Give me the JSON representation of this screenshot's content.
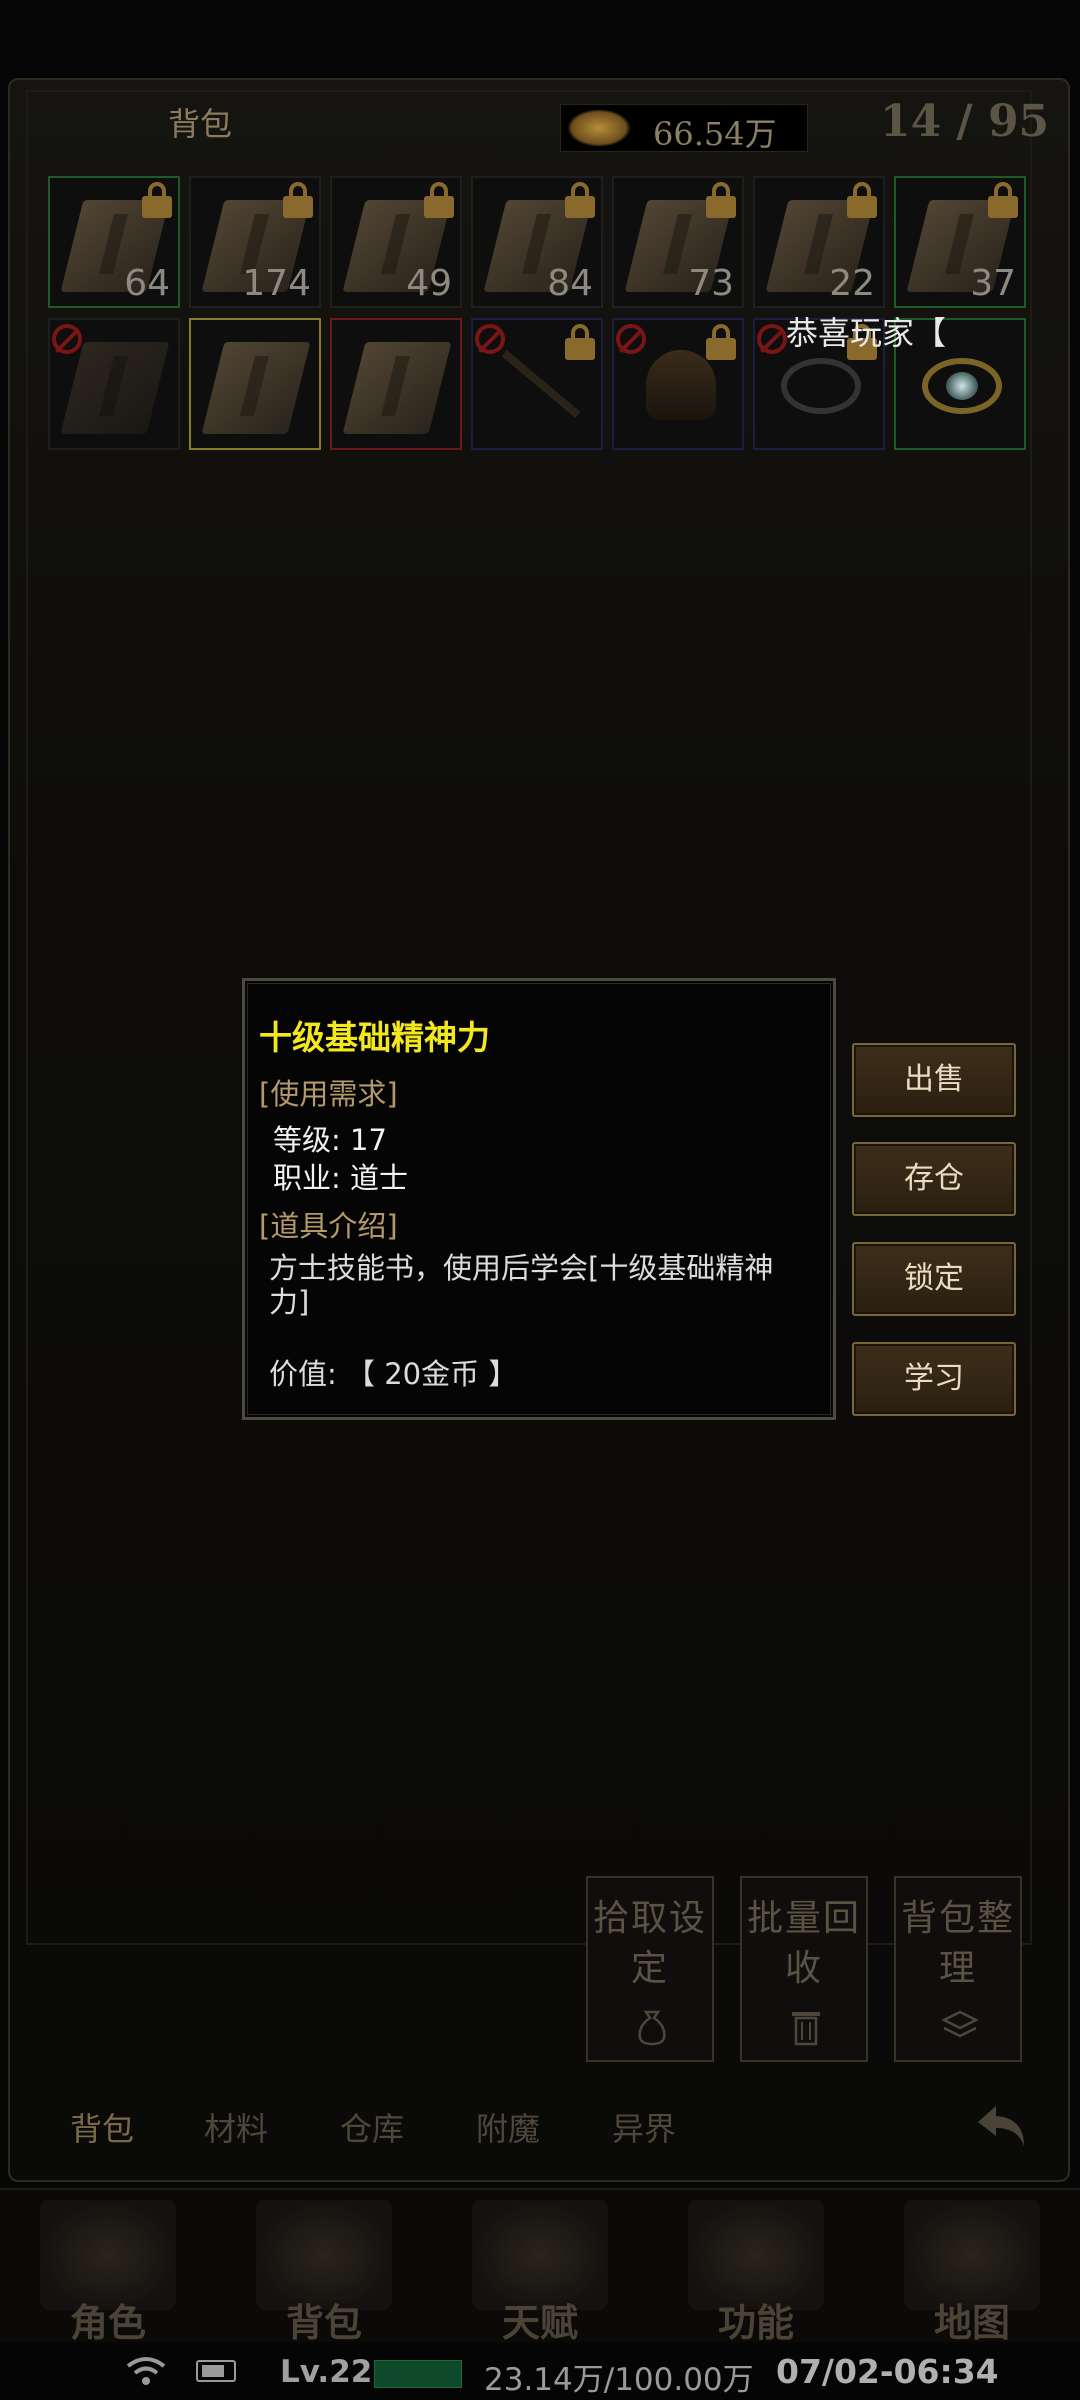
{
  "header": {
    "title": "背包",
    "gold": "66.54万",
    "capacity": "14 / 95"
  },
  "broadcast": "恭喜玩家【",
  "inventory": {
    "row1": [
      {
        "count": "64",
        "locked": true,
        "rarity": "green"
      },
      {
        "count": "174",
        "locked": true,
        "rarity": "gray"
      },
      {
        "count": "49",
        "locked": true,
        "rarity": "gray"
      },
      {
        "count": "84",
        "locked": true,
        "rarity": "gray"
      },
      {
        "count": "73",
        "locked": true,
        "rarity": "gray"
      },
      {
        "count": "22",
        "locked": true,
        "rarity": "gray"
      },
      {
        "count": "37",
        "locked": true,
        "rarity": "green"
      }
    ]
  },
  "tooltip": {
    "title": "十级基础精神力",
    "req_header": "[使用需求]",
    "level": "等级: 17",
    "job": "职业: 道士",
    "intro_header": "[道具介绍]",
    "description": "方士技能书，使用后学会[十级基础精神力]",
    "value": "价值: 【 20金币 】"
  },
  "actions": {
    "sell": "出售",
    "store": "存仓",
    "lock": "锁定",
    "learn": "学习"
  },
  "utility": {
    "pickup": "拾取设定",
    "recycle": "批量回收",
    "sort": "背包整理"
  },
  "tabs": [
    "背包",
    "材料",
    "仓库",
    "附魔",
    "异界"
  ],
  "nav": [
    "角色",
    "背包",
    "天赋",
    "功能",
    "地图"
  ],
  "status": {
    "level": "Lv.22",
    "exp": "23.14万/100.00万",
    "time": "07/02-06:34"
  },
  "colors": {
    "tooltip_title": "#f3e71e",
    "section_header": "#b49a6a",
    "button_border": "#7a6538"
  }
}
